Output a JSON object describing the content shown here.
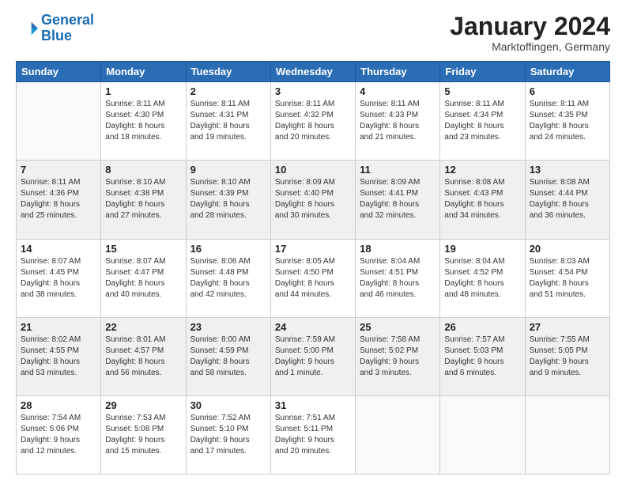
{
  "header": {
    "logo_line1": "General",
    "logo_line2": "Blue",
    "month_title": "January 2024",
    "location": "Marktoffingen, Germany"
  },
  "weekdays": [
    "Sunday",
    "Monday",
    "Tuesday",
    "Wednesday",
    "Thursday",
    "Friday",
    "Saturday"
  ],
  "weeks": [
    [
      {
        "day": "",
        "info": ""
      },
      {
        "day": "1",
        "info": "Sunrise: 8:11 AM\nSunset: 4:30 PM\nDaylight: 8 hours\nand 18 minutes."
      },
      {
        "day": "2",
        "info": "Sunrise: 8:11 AM\nSunset: 4:31 PM\nDaylight: 8 hours\nand 19 minutes."
      },
      {
        "day": "3",
        "info": "Sunrise: 8:11 AM\nSunset: 4:32 PM\nDaylight: 8 hours\nand 20 minutes."
      },
      {
        "day": "4",
        "info": "Sunrise: 8:11 AM\nSunset: 4:33 PM\nDaylight: 8 hours\nand 21 minutes."
      },
      {
        "day": "5",
        "info": "Sunrise: 8:11 AM\nSunset: 4:34 PM\nDaylight: 8 hours\nand 23 minutes."
      },
      {
        "day": "6",
        "info": "Sunrise: 8:11 AM\nSunset: 4:35 PM\nDaylight: 8 hours\nand 24 minutes."
      }
    ],
    [
      {
        "day": "7",
        "info": "Sunrise: 8:11 AM\nSunset: 4:36 PM\nDaylight: 8 hours\nand 25 minutes."
      },
      {
        "day": "8",
        "info": "Sunrise: 8:10 AM\nSunset: 4:38 PM\nDaylight: 8 hours\nand 27 minutes."
      },
      {
        "day": "9",
        "info": "Sunrise: 8:10 AM\nSunset: 4:39 PM\nDaylight: 8 hours\nand 28 minutes."
      },
      {
        "day": "10",
        "info": "Sunrise: 8:09 AM\nSunset: 4:40 PM\nDaylight: 8 hours\nand 30 minutes."
      },
      {
        "day": "11",
        "info": "Sunrise: 8:09 AM\nSunset: 4:41 PM\nDaylight: 8 hours\nand 32 minutes."
      },
      {
        "day": "12",
        "info": "Sunrise: 8:08 AM\nSunset: 4:43 PM\nDaylight: 8 hours\nand 34 minutes."
      },
      {
        "day": "13",
        "info": "Sunrise: 8:08 AM\nSunset: 4:44 PM\nDaylight: 8 hours\nand 36 minutes."
      }
    ],
    [
      {
        "day": "14",
        "info": "Sunrise: 8:07 AM\nSunset: 4:45 PM\nDaylight: 8 hours\nand 38 minutes."
      },
      {
        "day": "15",
        "info": "Sunrise: 8:07 AM\nSunset: 4:47 PM\nDaylight: 8 hours\nand 40 minutes."
      },
      {
        "day": "16",
        "info": "Sunrise: 8:06 AM\nSunset: 4:48 PM\nDaylight: 8 hours\nand 42 minutes."
      },
      {
        "day": "17",
        "info": "Sunrise: 8:05 AM\nSunset: 4:50 PM\nDaylight: 8 hours\nand 44 minutes."
      },
      {
        "day": "18",
        "info": "Sunrise: 8:04 AM\nSunset: 4:51 PM\nDaylight: 8 hours\nand 46 minutes."
      },
      {
        "day": "19",
        "info": "Sunrise: 8:04 AM\nSunset: 4:52 PM\nDaylight: 8 hours\nand 48 minutes."
      },
      {
        "day": "20",
        "info": "Sunrise: 8:03 AM\nSunset: 4:54 PM\nDaylight: 8 hours\nand 51 minutes."
      }
    ],
    [
      {
        "day": "21",
        "info": "Sunrise: 8:02 AM\nSunset: 4:55 PM\nDaylight: 8 hours\nand 53 minutes."
      },
      {
        "day": "22",
        "info": "Sunrise: 8:01 AM\nSunset: 4:57 PM\nDaylight: 8 hours\nand 56 minutes."
      },
      {
        "day": "23",
        "info": "Sunrise: 8:00 AM\nSunset: 4:59 PM\nDaylight: 8 hours\nand 58 minutes."
      },
      {
        "day": "24",
        "info": "Sunrise: 7:59 AM\nSunset: 5:00 PM\nDaylight: 9 hours\nand 1 minute."
      },
      {
        "day": "25",
        "info": "Sunrise: 7:58 AM\nSunset: 5:02 PM\nDaylight: 9 hours\nand 3 minutes."
      },
      {
        "day": "26",
        "info": "Sunrise: 7:57 AM\nSunset: 5:03 PM\nDaylight: 9 hours\nand 6 minutes."
      },
      {
        "day": "27",
        "info": "Sunrise: 7:55 AM\nSunset: 5:05 PM\nDaylight: 9 hours\nand 9 minutes."
      }
    ],
    [
      {
        "day": "28",
        "info": "Sunrise: 7:54 AM\nSunset: 5:06 PM\nDaylight: 9 hours\nand 12 minutes."
      },
      {
        "day": "29",
        "info": "Sunrise: 7:53 AM\nSunset: 5:08 PM\nDaylight: 9 hours\nand 15 minutes."
      },
      {
        "day": "30",
        "info": "Sunrise: 7:52 AM\nSunset: 5:10 PM\nDaylight: 9 hours\nand 17 minutes."
      },
      {
        "day": "31",
        "info": "Sunrise: 7:51 AM\nSunset: 5:11 PM\nDaylight: 9 hours\nand 20 minutes."
      },
      {
        "day": "",
        "info": ""
      },
      {
        "day": "",
        "info": ""
      },
      {
        "day": "",
        "info": ""
      }
    ]
  ]
}
